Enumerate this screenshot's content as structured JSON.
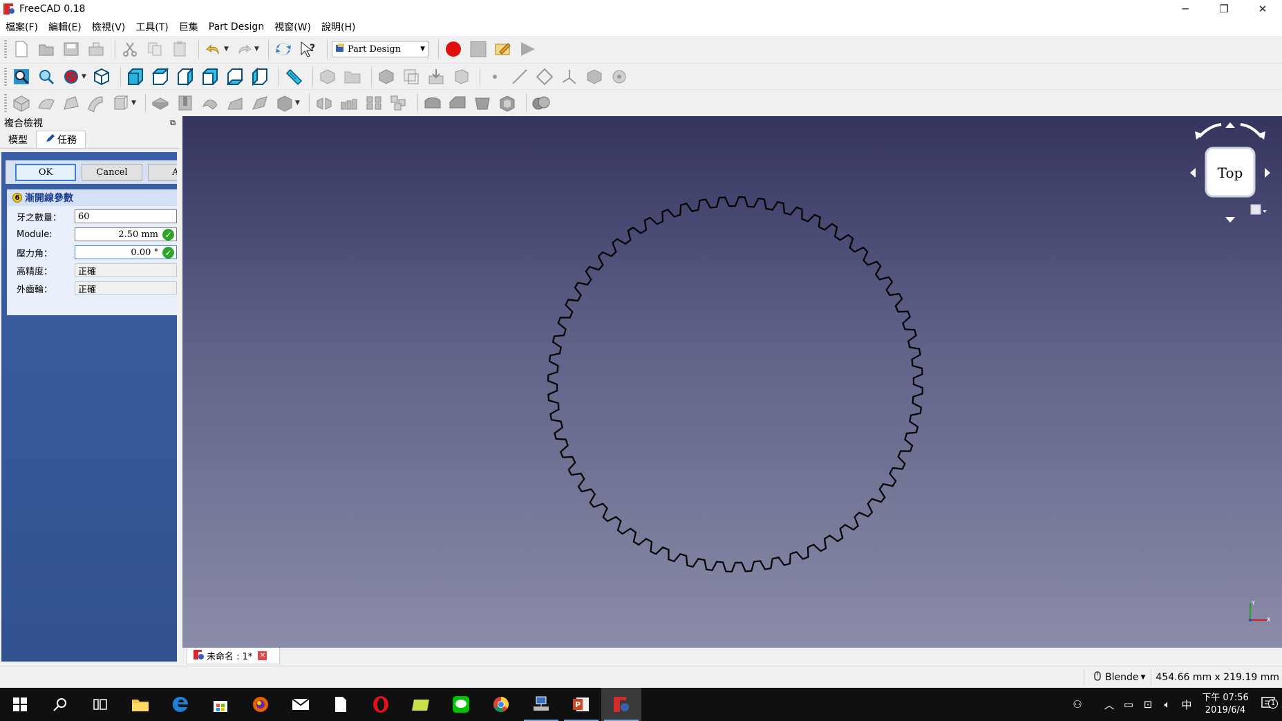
{
  "window": {
    "title": "FreeCAD 0.18",
    "controls": [
      "─",
      "❐",
      "✕"
    ]
  },
  "menu": [
    "檔案(F)",
    "編輯(E)",
    "檢視(V)",
    "工具(T)",
    "巨集",
    "Part Design",
    "視窗(W)",
    "說明(H)"
  ],
  "toolbar": {
    "workbench": "Part Design"
  },
  "combo": {
    "title": "複合檢視",
    "tabs": [
      "模型",
      "任務"
    ],
    "buttons": {
      "ok": "OK",
      "cancel": "Cancel",
      "apply": "Ap"
    },
    "section_number": "6",
    "section_title": "漸開線參數",
    "params": [
      {
        "label": "牙之數量：",
        "value": "60"
      },
      {
        "label": "Module:",
        "value": "2.50 mm"
      },
      {
        "label": "壓力角：",
        "value": "0.00 °"
      },
      {
        "label": "高精度：",
        "value": "正確"
      },
      {
        "label": "外齒輪：",
        "value": "正確"
      }
    ]
  },
  "viewport": {
    "navcube_face": "Top",
    "teeth": 60,
    "colors": {
      "bg_top": "#34345f",
      "bg_bottom": "#8a8ca8",
      "gear": "#000000"
    }
  },
  "document_tab": {
    "label": "未命名 : 1*"
  },
  "status": {
    "nav_style": "Blende",
    "dimensions": "454.66 mm x 219.19 mm"
  },
  "taskbar": {
    "ime": "中",
    "time": "下午 07:56",
    "date": "2019/6/4",
    "notifications": "1"
  }
}
